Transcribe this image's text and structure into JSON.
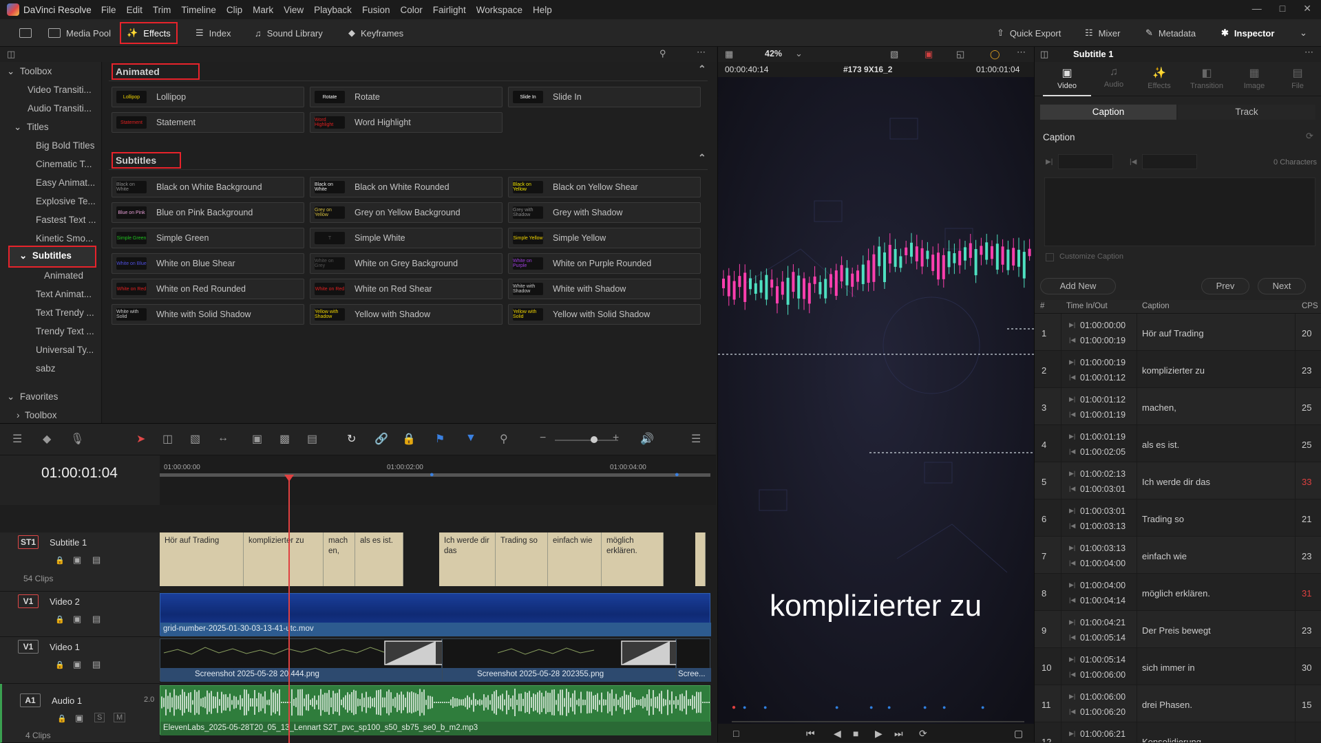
{
  "app": {
    "name": "DaVinci Resolve",
    "menu": [
      "File",
      "Edit",
      "Trim",
      "Timeline",
      "Clip",
      "Mark",
      "View",
      "Playback",
      "Fusion",
      "Color",
      "Fairlight",
      "Workspace",
      "Help"
    ]
  },
  "toolbar": {
    "media_pool": "Media Pool",
    "effects": "Effects",
    "index": "Index",
    "sound_library": "Sound Library",
    "keyframes": "Keyframes",
    "quick_export": "Quick Export",
    "mixer": "Mixer",
    "metadata": "Metadata",
    "inspector": "Inspector"
  },
  "left_tree": {
    "toolbox": "Toolbox",
    "video_transitions": "Video Transiti...",
    "audio_transitions": "Audio Transiti...",
    "titles": "Titles",
    "items": [
      "Big Bold Titles",
      "Cinematic T...",
      "Easy Animat...",
      "Explosive Te...",
      "Fastest Text ...",
      "Kinetic Smo..."
    ],
    "subtitles": "Subtitles",
    "subitems": [
      "Animated",
      "Text Animat...",
      "Text Trendy ...",
      "Trendy Text ...",
      "Universal Ty...",
      "sabz"
    ],
    "favorites": "Favorites",
    "fav_toolbox": "Toolbox"
  },
  "effects": {
    "animated_header": "Animated",
    "animated": [
      {
        "label": "Lollipop",
        "thumb": "Lollipop",
        "color": "#f2d600"
      },
      {
        "label": "Rotate",
        "thumb": "Rotate",
        "color": "#ffffff"
      },
      {
        "label": "Slide In",
        "thumb": "Slide In",
        "color": "#ffffff"
      },
      {
        "label": "Statement",
        "thumb": "Statement",
        "color": "#e02020"
      },
      {
        "label": "Word Highlight",
        "thumb": "Word Highlight",
        "color": "#e02020"
      }
    ],
    "subtitles_header": "Subtitles",
    "subtitles": [
      {
        "label": "Black on White Background",
        "thumb": "Black on White",
        "color": "#888888"
      },
      {
        "label": "Black on White Rounded",
        "thumb": "Black on White",
        "color": "#eeeeee"
      },
      {
        "label": "Black on Yellow Shear",
        "thumb": "Black on Yellow",
        "color": "#f2e600"
      },
      {
        "label": "Blue on Pink Background",
        "thumb": "Blue on Pink",
        "color": "#e8a0d8"
      },
      {
        "label": "Grey on Yellow Background",
        "thumb": "Grey on Yellow",
        "color": "#d8c040"
      },
      {
        "label": "Grey with Shadow",
        "thumb": "Grey with Shadow",
        "color": "#888888"
      },
      {
        "label": "Simple Green",
        "thumb": "Simple Green",
        "color": "#20c020"
      },
      {
        "label": "Simple White",
        "thumb": "T",
        "color": "#555555"
      },
      {
        "label": "Simple Yellow",
        "thumb": "Simple Yellow",
        "color": "#f2d600"
      },
      {
        "label": "White on Blue Shear",
        "thumb": "White on Blue",
        "color": "#5050e0"
      },
      {
        "label": "White on Grey Background",
        "thumb": "White on Grey",
        "color": "#555555"
      },
      {
        "label": "White on Purple Rounded",
        "thumb": "White on Purple",
        "color": "#a040e0"
      },
      {
        "label": "White on Red Rounded",
        "thumb": "White on Red",
        "color": "#e02020"
      },
      {
        "label": "White on Red Shear",
        "thumb": "White on Red",
        "color": "#e02020"
      },
      {
        "label": "White with Shadow",
        "thumb": "White with Shadow",
        "color": "#cccccc"
      },
      {
        "label": "White with Solid Shadow",
        "thumb": "White with Solid",
        "color": "#cccccc"
      },
      {
        "label": "Yellow with Shadow",
        "thumb": "Yellow with Shadow",
        "color": "#f2d600"
      },
      {
        "label": "Yellow with Solid Shadow",
        "thumb": "Yellow with Solid",
        "color": "#f2d600"
      }
    ]
  },
  "viewer": {
    "zoom": "42%",
    "timecode_left": "00:00:40:14",
    "clip_name": "#173 9X16_2",
    "timecode_right": "01:00:01:04",
    "subtitle_text": "komplizierter zu"
  },
  "inspector": {
    "title": "Subtitle 1",
    "tabs": [
      "Video",
      "Audio",
      "Effects",
      "Transition",
      "Image",
      "File"
    ],
    "sub_tabs": [
      "Caption",
      "Track"
    ],
    "caption_label": "Caption",
    "characters": "0 Characters",
    "customize": "Customize Caption",
    "add_new": "Add New",
    "prev": "Prev",
    "next": "Next",
    "columns": [
      "#",
      "Time In/Out",
      "Caption",
      "CPS"
    ],
    "rows": [
      {
        "n": "1",
        "in": "01:00:00:00",
        "out": "01:00:00:19",
        "caption": "Hör auf Trading",
        "cps": "20",
        "red": false
      },
      {
        "n": "2",
        "in": "01:00:00:19",
        "out": "01:00:01:12",
        "caption": "komplizierter zu",
        "cps": "23",
        "red": false
      },
      {
        "n": "3",
        "in": "01:00:01:12",
        "out": "01:00:01:19",
        "caption": "machen,",
        "cps": "25",
        "red": false
      },
      {
        "n": "4",
        "in": "01:00:01:19",
        "out": "01:00:02:05",
        "caption": "als es ist.",
        "cps": "25",
        "red": false
      },
      {
        "n": "5",
        "in": "01:00:02:13",
        "out": "01:00:03:01",
        "caption": "Ich werde dir das",
        "cps": "33",
        "red": true
      },
      {
        "n": "6",
        "in": "01:00:03:01",
        "out": "01:00:03:13",
        "caption": "Trading so",
        "cps": "21",
        "red": false
      },
      {
        "n": "7",
        "in": "01:00:03:13",
        "out": "01:00:04:00",
        "caption": "einfach wie",
        "cps": "23",
        "red": false
      },
      {
        "n": "8",
        "in": "01:00:04:00",
        "out": "01:00:04:14",
        "caption": "möglich erklären.",
        "cps": "31",
        "red": true
      },
      {
        "n": "9",
        "in": "01:00:04:21",
        "out": "01:00:05:14",
        "caption": "Der Preis bewegt",
        "cps": "23",
        "red": false
      },
      {
        "n": "10",
        "in": "01:00:05:14",
        "out": "01:00:06:00",
        "caption": "sich immer in",
        "cps": "30",
        "red": false
      },
      {
        "n": "11",
        "in": "01:00:06:00",
        "out": "01:00:06:20",
        "caption": "drei Phasen.",
        "cps": "15",
        "red": false
      },
      {
        "n": "12",
        "in": "01:00:06:21",
        "out": "",
        "caption": "Konsolidierung",
        "cps": "",
        "red": false
      }
    ]
  },
  "timeline": {
    "timecode": "01:00:01:04",
    "ruler": [
      "01:00:00:00",
      "01:00:02:00",
      "01:00:04:00"
    ],
    "tracks": {
      "st1": {
        "tag": "ST1",
        "name": "Subtitle 1",
        "clips_count": "54 Clips"
      },
      "v2": {
        "tag": "V1",
        "name": "Video 2",
        "clip": "grid-number-2025-01-30-03-13-41-utc.mov"
      },
      "v1": {
        "tag": "V1",
        "name": "Video 1",
        "clip_a": "Screenshot 2025-05-28 20.444.png",
        "clip_b": "Screenshot 2025-05-28 202355.png",
        "clip_c": "Scree..."
      },
      "a1": {
        "tag": "A1",
        "name": "Audio 1",
        "level": "2.0",
        "clips_count": "4 Clips",
        "clip": "ElevenLabs_2025-05-28T20_05_13_Lennart S2T_pvc_sp100_s50_sb75_se0_b_m2.mp3"
      }
    },
    "subtitle_clips": [
      {
        "text": "Hör auf Trading"
      },
      {
        "text": "komplizierter zu"
      },
      {
        "text": "mach en,"
      },
      {
        "text": "als es ist."
      },
      {
        "text": "Ich werde dir das"
      },
      {
        "text": "Trading so"
      },
      {
        "text": "einfach wie"
      },
      {
        "text": "möglich erklären."
      },
      {
        "text": ""
      }
    ]
  }
}
